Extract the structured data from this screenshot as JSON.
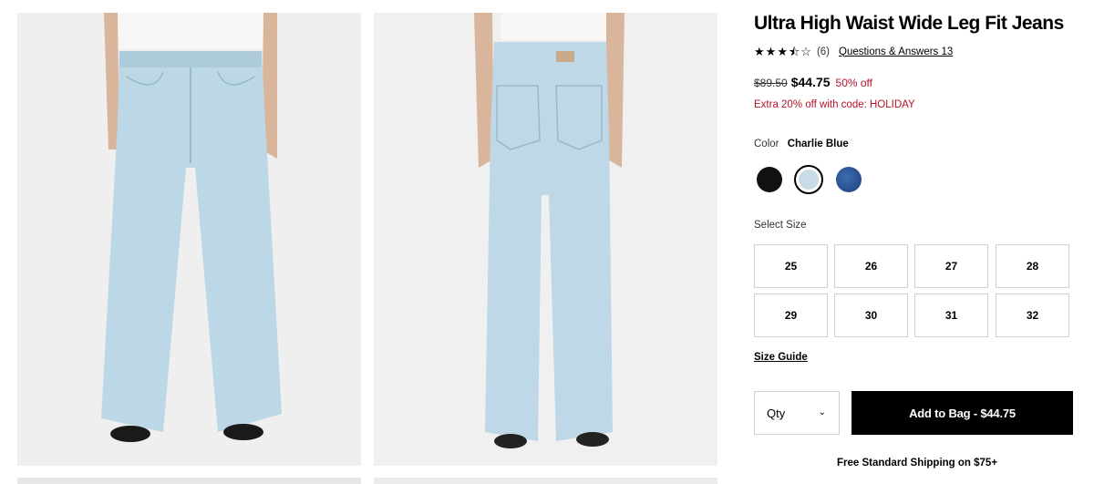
{
  "product": {
    "title": "Ultra High Waist Wide Leg Fit Jeans",
    "rating_stars": 3.5,
    "rating_count": "(6)",
    "qa_link": "Questions & Answers 13",
    "price_original": "$89.50",
    "price_sale": "$44.75",
    "discount": "50% off",
    "promo": "Extra 20% off with code: HOLIDAY"
  },
  "color": {
    "label": "Color",
    "selected": "Charlie Blue",
    "swatches": [
      {
        "name": "black",
        "hex": "#121212"
      },
      {
        "name": "charlie-blue",
        "hex": "#c9dbe6"
      },
      {
        "name": "dark-blue",
        "hex": "#2a559a"
      }
    ]
  },
  "size": {
    "label": "Select Size",
    "options": [
      "25",
      "26",
      "27",
      "28",
      "29",
      "30",
      "31",
      "32"
    ],
    "guide_link": "Size Guide"
  },
  "purchase": {
    "qty_label": "Qty",
    "add_to_bag": "Add to Bag - $44.75",
    "shipping_note": "Free Standard Shipping on $75+"
  },
  "colors": {
    "sale_red": "#b3132a",
    "button_black": "#000000"
  }
}
